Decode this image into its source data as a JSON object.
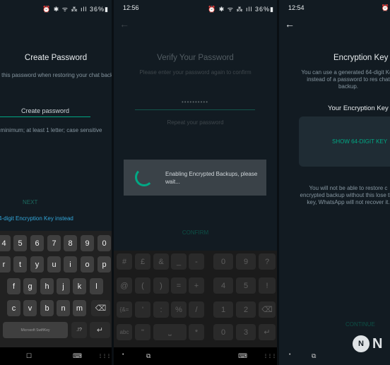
{
  "status": {
    "p1_icons": "⏰ ✱ ᯤ ⁂ ıll 36%▮",
    "p2_time": "12:56",
    "p2_icons": "⏰ ✱ ᯤ ⁂ ıll 36%▮",
    "p3_time": "12:54",
    "p3_icons": "⏰"
  },
  "create": {
    "title": "Create Password",
    "subtitle": "ed this password when restoring your chat backup",
    "placeholder": "Create password",
    "hint": "r minimum; at least 1 letter; case sensitive",
    "next": "NEXT",
    "link": "4-digit Encryption Key instead"
  },
  "keyboard": {
    "numbers": [
      "4",
      "5",
      "6",
      "7",
      "8",
      "9",
      "0"
    ],
    "row1": [
      "r",
      "t",
      "y",
      "u",
      "i",
      "o",
      "p"
    ],
    "row2": [
      "f",
      "g",
      "h",
      "j",
      "k",
      "l"
    ],
    "row3": [
      "c",
      "v",
      "b",
      "n",
      "m"
    ],
    "backspace": "⌫",
    "space": "Microsoft SwiftKey",
    "punct": ".!?",
    "enter": "↵"
  },
  "verify": {
    "title": "Verify Your Password",
    "subtitle": "Please enter your password again to confirm",
    "masked": "••••••••••",
    "repeat": "Repeat your password",
    "dialog_text": "Enabling Encrypted Backups, please wait...",
    "confirm": "CONFIRM"
  },
  "symbols": {
    "row1": [
      "#",
      "£",
      "&",
      "_",
      "-",
      "0",
      "9",
      "?"
    ],
    "row2": [
      "@",
      "(",
      ")",
      "=",
      "+",
      "4",
      "5",
      "!"
    ],
    "row3": [
      "{&=",
      "'",
      ":",
      "%",
      "/",
      "1",
      "2",
      "⌫"
    ],
    "row4": [
      "abc",
      "\"",
      "⎵",
      "*",
      "0",
      "3",
      "↵"
    ]
  },
  "key": {
    "title": "Encryption Key",
    "subtitle": "You can use a generated 64-digit Key instead of a password to res chat backup.",
    "label": "Your Encryption Key",
    "show": "SHOW 64-DIGIT KEY",
    "warning": "You will not be able to restore c encrypted backup without this lose this key, WhatsApp will not recover it.",
    "continue": "CONTINUE",
    "watermark_letter": "N",
    "watermark_text": "N"
  },
  "nav": {
    "home": "☐",
    "recents": "⧉",
    "keyboard": "⌨",
    "dots": "⋮⋮⋮",
    "dot": "•"
  },
  "colors": {
    "background": "#121b22",
    "accent": "#00a884",
    "link": "#32a6d9"
  }
}
